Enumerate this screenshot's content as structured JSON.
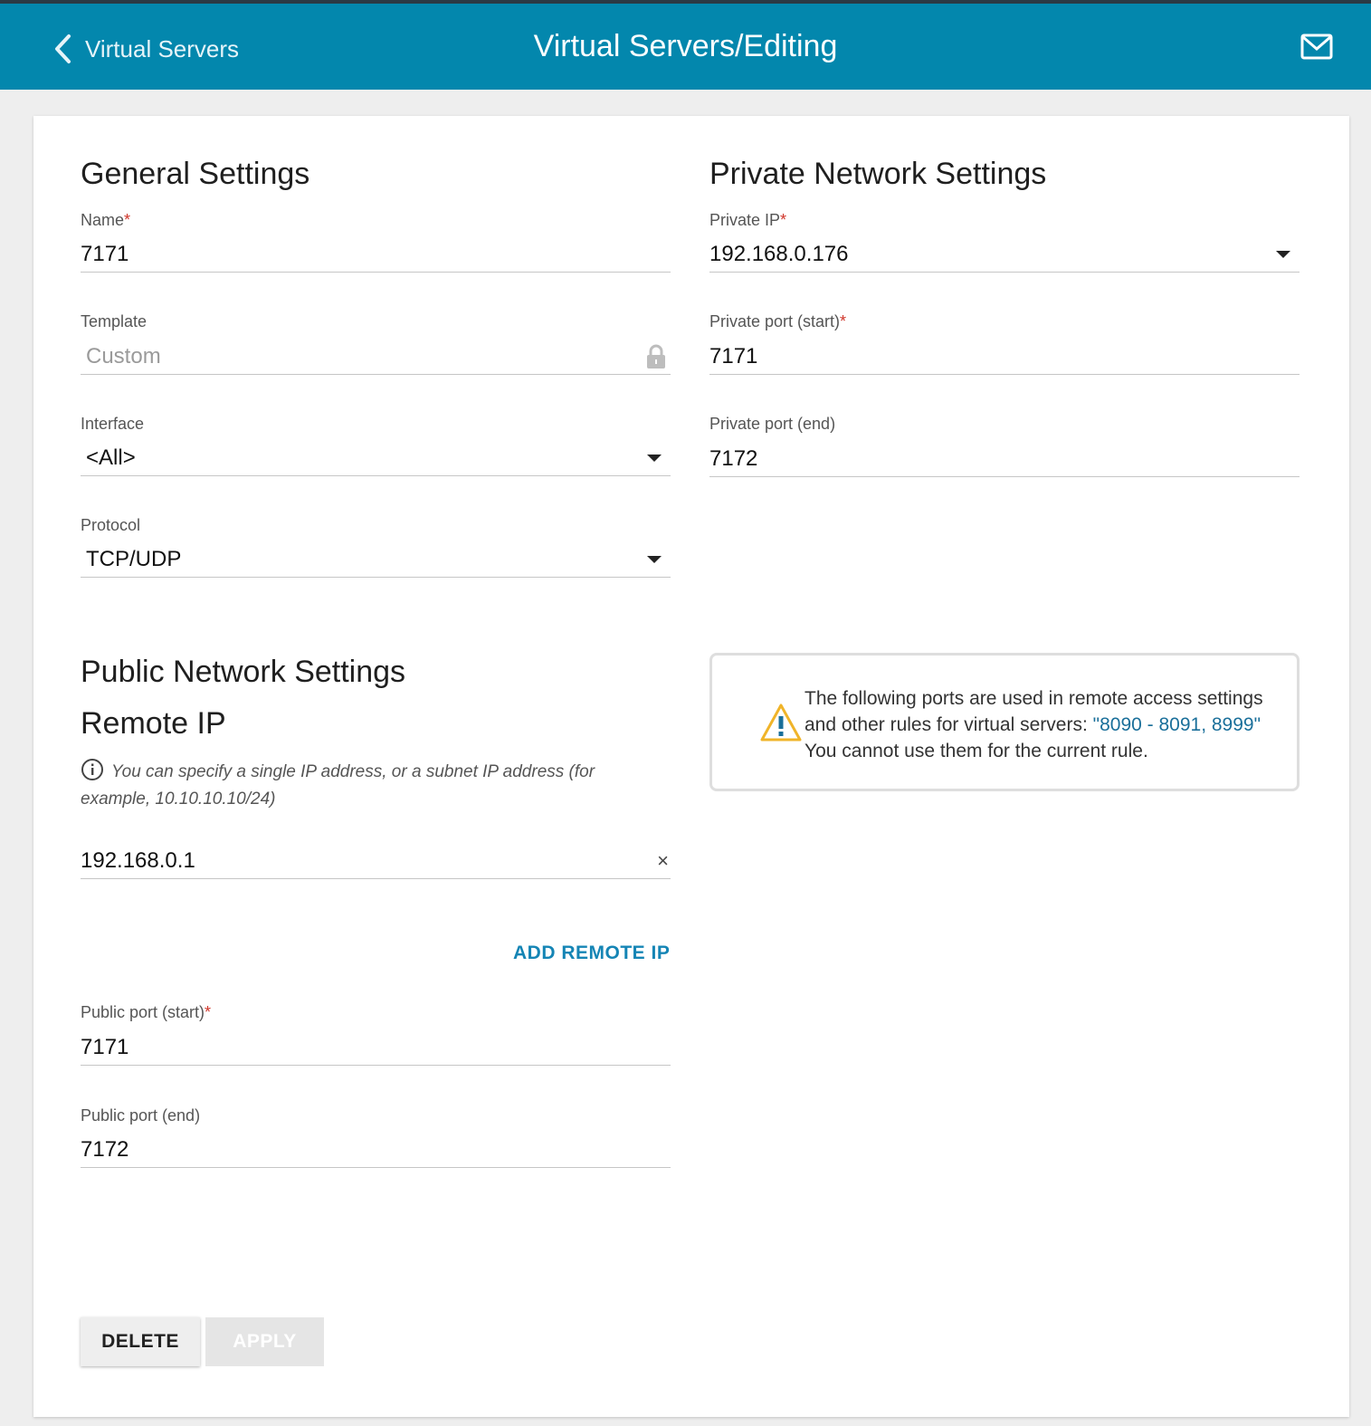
{
  "header": {
    "back_label": "Virtual Servers",
    "title": "Virtual Servers/Editing",
    "mail_icon": "mail-icon"
  },
  "general": {
    "heading": "General Settings",
    "name_label": "Name",
    "name_value": "7171",
    "template_label": "Template",
    "template_value": "Custom",
    "interface_label": "Interface",
    "interface_value": "<All>",
    "protocol_label": "Protocol",
    "protocol_value": "TCP/UDP"
  },
  "private": {
    "heading": "Private Network Settings",
    "ip_label": "Private IP",
    "ip_value": "192.168.0.176",
    "port_start_label": "Private port (start)",
    "port_start_value": "7171",
    "port_end_label": "Private port (end)",
    "port_end_value": "7172"
  },
  "public": {
    "heading": "Public Network Settings",
    "remote_heading": "Remote IP",
    "hint": "You can specify a single IP address, or a subnet IP address (for example, 10.10.10.10/24)",
    "remote_ip_value": "192.168.0.1",
    "clear_symbol": "×",
    "add_remote_ip": "ADD REMOTE IP",
    "port_start_label": "Public port (start)",
    "port_start_value": "7171",
    "port_end_label": "Public port (end)",
    "port_end_value": "7172"
  },
  "warning": {
    "text_before": "The following ports are used in remote access settings and other rules for virtual servers: ",
    "ports": "\"8090 - 8091, 8999\"",
    "text_after": " You cannot use them for the current rule."
  },
  "required_mark": "*",
  "buttons": {
    "delete": "DELETE",
    "apply": "APPLY"
  },
  "colors": {
    "header_bg": "#0387ad",
    "accent": "#1585b5",
    "required": "#d0352a",
    "warning_icon": "#f0b429"
  }
}
